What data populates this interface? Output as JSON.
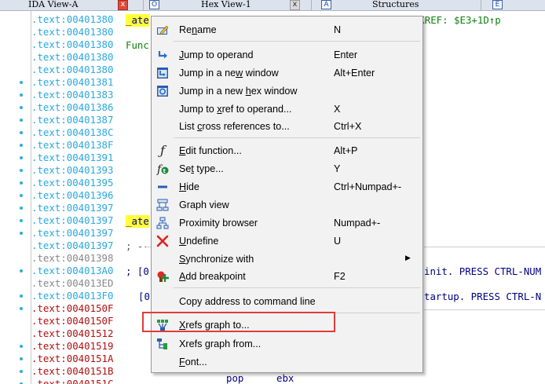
{
  "tabs": [
    {
      "label": "IDA View-A",
      "close": "x",
      "active": true
    },
    {
      "label": "Hex View-1",
      "close": "x",
      "active": false
    },
    {
      "label": "Structures",
      "close": "",
      "active": false
    }
  ],
  "tab_icons": {
    "hex_icon": "O",
    "structures_icon": "A",
    "enum_icon": "E"
  },
  "disasm": {
    "rows": [
      {
        "prefix": ".text:",
        "addr": "00401380",
        "color": "blue"
      },
      {
        "prefix": ".text:",
        "addr": "00401380",
        "color": "blue"
      },
      {
        "prefix": ".text:",
        "addr": "00401380",
        "color": "blue"
      },
      {
        "prefix": ".text:",
        "addr": "00401380",
        "color": "blue"
      },
      {
        "prefix": ".text:",
        "addr": "00401380",
        "color": "blue"
      },
      {
        "prefix": ".text:",
        "addr": "00401381",
        "color": "blue"
      },
      {
        "prefix": ".text:",
        "addr": "00401383",
        "color": "blue"
      },
      {
        "prefix": ".text:",
        "addr": "00401386",
        "color": "blue"
      },
      {
        "prefix": ".text:",
        "addr": "00401387",
        "color": "blue"
      },
      {
        "prefix": ".text:",
        "addr": "0040138C",
        "color": "blue"
      },
      {
        "prefix": ".text:",
        "addr": "0040138F",
        "color": "blue"
      },
      {
        "prefix": ".text:",
        "addr": "00401391",
        "color": "blue"
      },
      {
        "prefix": ".text:",
        "addr": "00401393",
        "color": "blue"
      },
      {
        "prefix": ".text:",
        "addr": "00401395",
        "color": "blue"
      },
      {
        "prefix": ".text:",
        "addr": "00401396",
        "color": "blue"
      },
      {
        "prefix": ".text:",
        "addr": "00401397",
        "color": "blue"
      },
      {
        "prefix": ".text:",
        "addr": "00401397",
        "color": "blue"
      },
      {
        "prefix": ".text:",
        "addr": "00401397",
        "color": "blue"
      },
      {
        "prefix": ".text:",
        "addr": "00401397",
        "color": "blue"
      },
      {
        "prefix": ".text:",
        "addr": "00401398",
        "color": "gray"
      },
      {
        "prefix": ".text:",
        "addr": "004013A0",
        "color": "blue"
      },
      {
        "prefix": ".text:",
        "addr": "004013ED",
        "color": "gray"
      },
      {
        "prefix": ".text:",
        "addr": "004013F0",
        "color": "blue"
      },
      {
        "prefix": ".text:",
        "addr": "0040150F",
        "color": "red"
      },
      {
        "prefix": ".text:",
        "addr": "0040150F",
        "color": "red"
      },
      {
        "prefix": ".text:",
        "addr": "00401512",
        "color": "red"
      },
      {
        "prefix": ".text:",
        "addr": "00401519",
        "color": "red"
      },
      {
        "prefix": ".text:",
        "addr": "0040151A",
        "color": "red"
      },
      {
        "prefix": ".text:",
        "addr": "0040151B",
        "color": "red"
      },
      {
        "prefix": ".text:",
        "addr": "0040151C",
        "color": "red"
      }
    ],
    "label_top": "_ate",
    "label_mid": "_ate",
    "func_text": "Func",
    "xref_text": "CODE XREF: $E3+1D↑p",
    "bracket1": ";  [0",
    "bracket2": "[0",
    "init_text": "init. PRESS CTRL-NUM",
    "startup_text": "tartup. PRESS CTRL-N",
    "dashes1": "; ---",
    "dashes2": "; ---",
    "pop_op": "pop",
    "pop_arg": "ebx"
  },
  "menu": {
    "items": [
      {
        "label": "Rename",
        "key": "N",
        "icon": "rename-icon"
      },
      {
        "label": "Jump to operand",
        "key": "Enter",
        "icon": "jump-operand-icon"
      },
      {
        "label": "Jump in a new window",
        "key": "Alt+Enter",
        "icon": "jump-new-window-icon"
      },
      {
        "label": "Jump in a new hex window",
        "key": "",
        "icon": "jump-hex-window-icon"
      },
      {
        "label": "Jump to xref to operand...",
        "key": "X",
        "icon": ""
      },
      {
        "label": "List cross references to...",
        "key": "Ctrl+X",
        "icon": ""
      },
      {
        "label": "Edit function...",
        "key": "Alt+P",
        "icon": "function-icon"
      },
      {
        "label": "Set type...",
        "key": "Y",
        "icon": "set-type-icon"
      },
      {
        "label": "Hide",
        "key": "Ctrl+Numpad+-",
        "icon": "hide-icon"
      },
      {
        "label": "Graph view",
        "key": "",
        "icon": "graph-view-icon"
      },
      {
        "label": "Proximity browser",
        "key": "Numpad+-",
        "icon": "proximity-browser-icon"
      },
      {
        "label": "Undefine",
        "key": "U",
        "icon": "undefine-icon"
      },
      {
        "label": "Synchronize with",
        "key": "",
        "icon": "",
        "submenu": "▶"
      },
      {
        "label": "Add breakpoint",
        "key": "F2",
        "icon": "breakpoint-icon"
      },
      {
        "label": "Copy address to command line",
        "key": "",
        "icon": ""
      },
      {
        "label": "Xrefs graph to...",
        "key": "",
        "icon": "xrefs-graph-to-icon"
      },
      {
        "label": "Xrefs graph from...",
        "key": "",
        "icon": "xrefs-graph-from-icon"
      },
      {
        "label": "Font...",
        "key": "",
        "icon": ""
      }
    ]
  },
  "colors": {
    "address_blue": "#2aa8e0",
    "address_red": "#b01010",
    "highlight": "#ffff3a",
    "focus_box": "#e03c3c"
  }
}
